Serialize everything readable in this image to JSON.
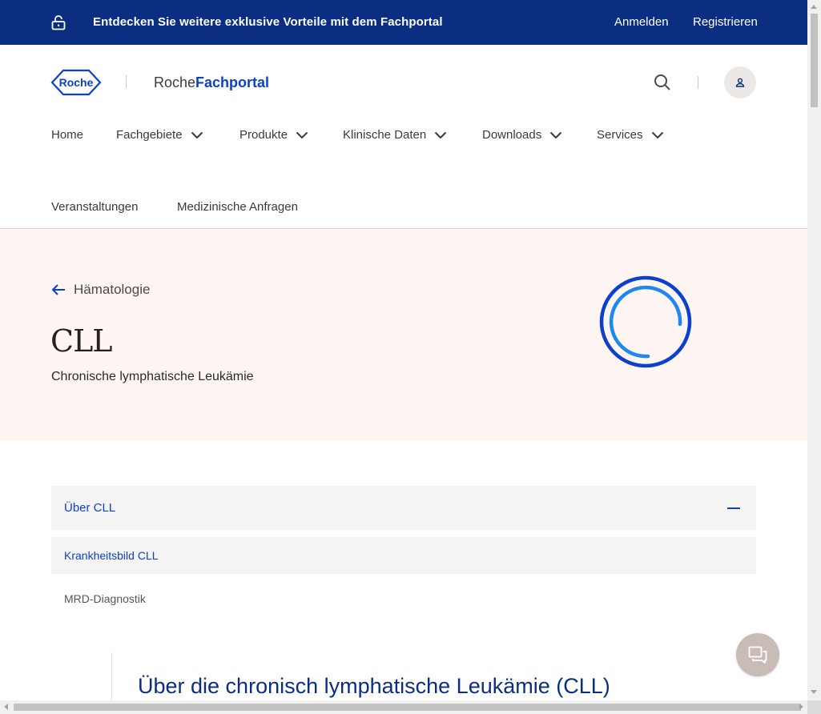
{
  "promo": {
    "text": "Entdecken Sie weitere exklusive Vorteile mit dem Fachportal",
    "login": "Anmelden",
    "register": "Registrieren"
  },
  "header": {
    "roche_logo_text": "Roche",
    "portal_prefix": "Roche",
    "portal_name": "Fachportal"
  },
  "nav": {
    "items": [
      {
        "label": "Home",
        "has_dropdown": false
      },
      {
        "label": "Fachgebiete",
        "has_dropdown": true
      },
      {
        "label": "Produkte",
        "has_dropdown": true
      },
      {
        "label": "Klinische Daten",
        "has_dropdown": true
      },
      {
        "label": "Downloads",
        "has_dropdown": true
      },
      {
        "label": "Services",
        "has_dropdown": true
      },
      {
        "label": "Veranstaltungen",
        "has_dropdown": false
      },
      {
        "label": "Medizinische Anfragen",
        "has_dropdown": false
      }
    ]
  },
  "hero": {
    "back_label": "Hämatologie",
    "title": "CLL",
    "subtitle": "Chronische lymphatische Leukämie"
  },
  "accordion": {
    "header": "Über CLL",
    "items": [
      {
        "label": "Krankheitsbild CLL",
        "active": true
      },
      {
        "label": "MRD-Diagnostik",
        "active": false
      }
    ]
  },
  "content": {
    "heading": "Über die chronisch lymphatische Leukämie (CLL)"
  },
  "colors": {
    "brand_dark_blue": "#0b2e82",
    "link_blue": "#0b41cd",
    "hero_bg": "#fff5f3",
    "accordion_bg": "#f5f4f2",
    "chat_bg": "#c9bcb6"
  },
  "icons": [
    "lock-icon",
    "search-icon",
    "user-icon",
    "chevron-down-icon",
    "arrow-left-icon",
    "circle-logo-icon",
    "chat-icon"
  ]
}
